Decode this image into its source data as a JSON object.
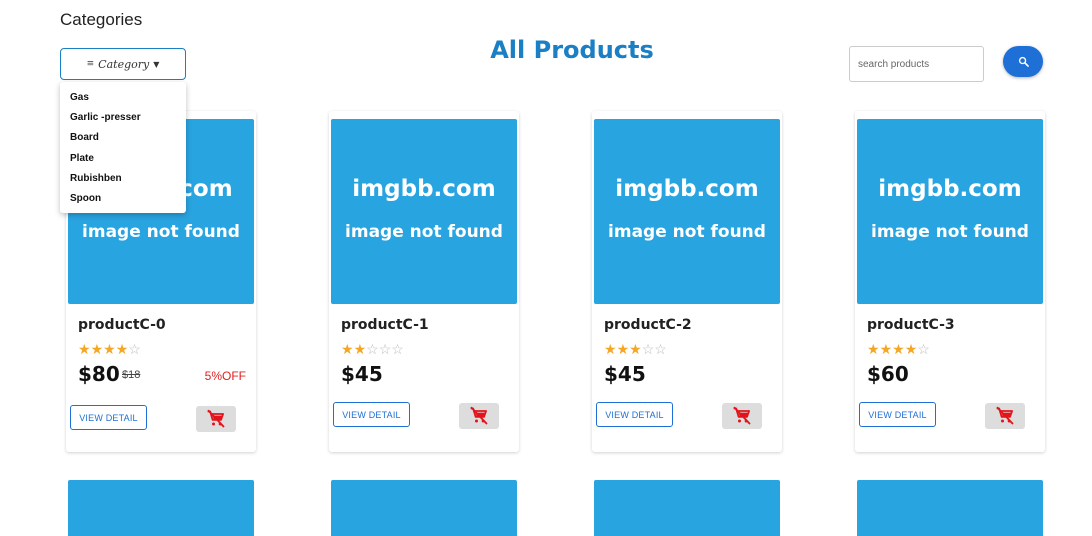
{
  "header": {
    "categories_heading": "Categories",
    "title": "All Products",
    "category_button_label": "Category",
    "search_placeholder": "search products"
  },
  "category_menu": {
    "items": [
      "Gas",
      "Garlic -presser",
      "Board",
      "Plate",
      "Rubishben",
      "Spoon"
    ]
  },
  "placeholder_image": {
    "line1": "imgbb.com",
    "line2": "image not found"
  },
  "products": [
    {
      "name": "productC-0",
      "rating": 4,
      "max_rating": 5,
      "price": "$80",
      "old_price": "$18",
      "discount": "5%OFF"
    },
    {
      "name": "productC-1",
      "rating": 2,
      "max_rating": 5,
      "price": "$45"
    },
    {
      "name": "productC-2",
      "rating": 3,
      "max_rating": 5,
      "price": "$45"
    },
    {
      "name": "productC-3",
      "rating": 4,
      "max_rating": 5,
      "price": "$60"
    }
  ],
  "buttons": {
    "view_detail": "VIEW DETAIL"
  },
  "colors": {
    "accent": "#1a7fc4",
    "search_button": "#1e6fd6",
    "image_bg": "#28a4e0",
    "star": "#f5a623",
    "discount": "#e02020",
    "cart_icon": "#e3131b"
  },
  "icons": {
    "filter": "filter-icon",
    "dropdown": "caret-down-icon",
    "search": "search-icon",
    "cart": "remove-shopping-cart-icon"
  }
}
